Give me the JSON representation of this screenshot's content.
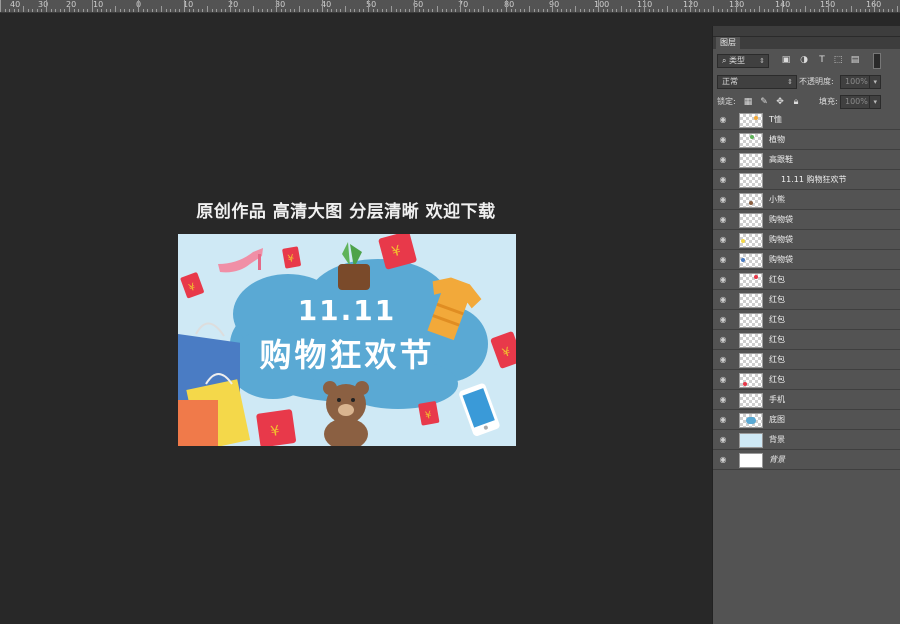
{
  "ruler": {
    "labels": [
      "40",
      "30",
      "20",
      "10",
      "0",
      "10",
      "20",
      "30",
      "40",
      "50",
      "60",
      "70",
      "80",
      "90",
      "100",
      "110",
      "120",
      "130",
      "140",
      "150",
      "160"
    ]
  },
  "canvas": {
    "caption": "原创作品 高清大图 分层清晰 欢迎下载",
    "banner": {
      "title_number": "11.11",
      "title_text": "购物狂欢节",
      "background_color": "#cfe9f5",
      "cloud_color": "#5aa9d4"
    }
  },
  "panel": {
    "tab_label": "图层",
    "filter": {
      "label": "类型"
    },
    "blend": {
      "mode": "正常",
      "opacity_label": "不透明度:",
      "opacity_value": "100%"
    },
    "lock": {
      "label": "锁定:",
      "fill_label": "填充:",
      "fill_value": "100%"
    },
    "layers": [
      {
        "name": "T恤"
      },
      {
        "name": "植物"
      },
      {
        "name": "高跟鞋"
      },
      {
        "name": "11.11  购物狂欢节"
      },
      {
        "name": "小熊"
      },
      {
        "name": "购物袋"
      },
      {
        "name": "购物袋"
      },
      {
        "name": "购物袋"
      },
      {
        "name": "红包"
      },
      {
        "name": "红包"
      },
      {
        "name": "红包"
      },
      {
        "name": "红包"
      },
      {
        "name": "红包"
      },
      {
        "name": "红包"
      },
      {
        "name": "手机"
      },
      {
        "name": "底图"
      },
      {
        "name": "背景"
      },
      {
        "name": "背景"
      }
    ]
  },
  "colors": {
    "workspace": "#282828",
    "panel": "#535353",
    "accent_red": "#e8394a",
    "accent_yellow": "#f2c12e"
  }
}
